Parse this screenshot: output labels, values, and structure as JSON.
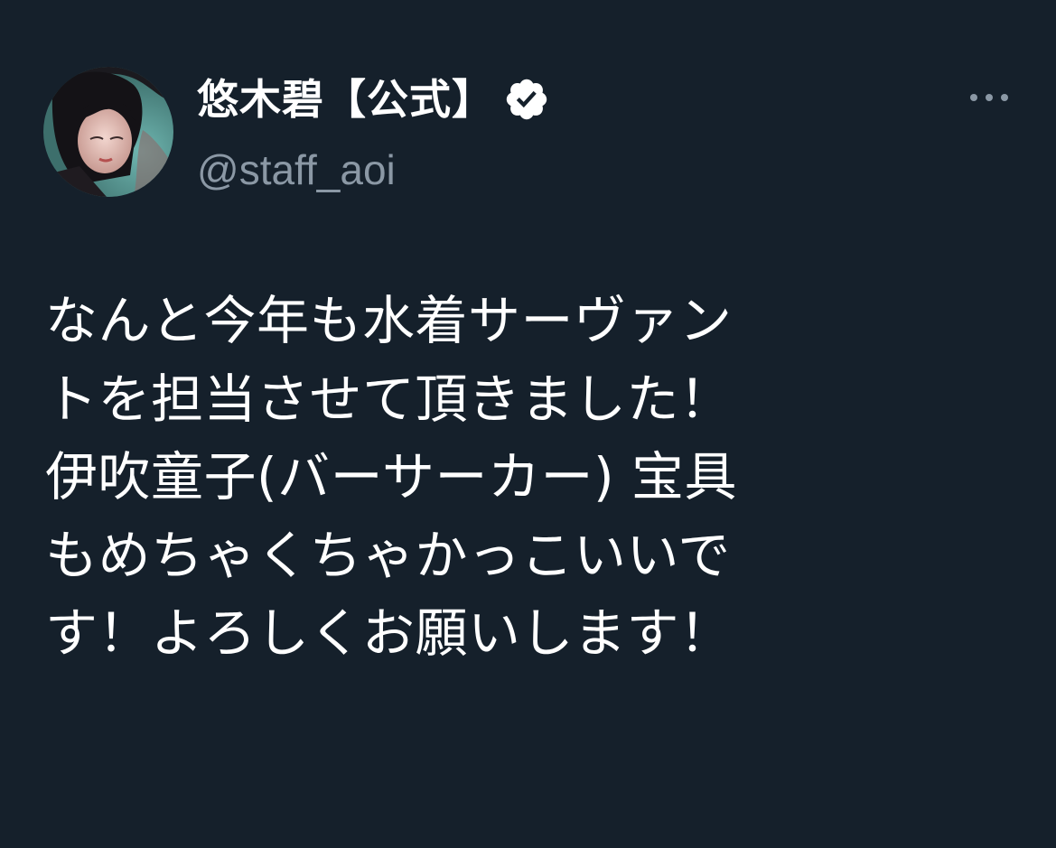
{
  "user": {
    "display_name": "悠木碧【公式】",
    "handle": "@staff_aoi",
    "verified": true
  },
  "icons": {
    "avatar": "avatar",
    "verified": "verified-badge-icon",
    "more": "more-options-icon"
  },
  "colors": {
    "background": "#15202b",
    "text_primary": "#ffffff",
    "text_secondary": "#8b98a5"
  },
  "tweet": {
    "lines": [
      "なんと今年も水着サーヴァン",
      "トを担当させて頂きました！",
      "伊吹童子(バーサーカー) 宝具",
      "もめちゃくちゃかっこいいで",
      "す！よろしくお願いします！"
    ]
  }
}
